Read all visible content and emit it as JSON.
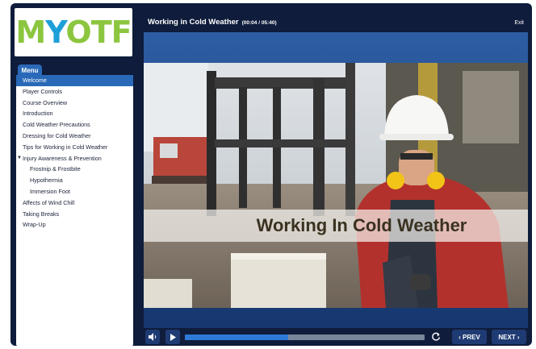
{
  "logo": {
    "text_pre": "M",
    "text_y": "Y",
    "text_post": "OTF"
  },
  "menu": {
    "tab_label": "Menu",
    "items": [
      {
        "label": "Welcome",
        "active": true
      },
      {
        "label": "Player Controls"
      },
      {
        "label": "Course Overview"
      },
      {
        "label": "Introduction"
      },
      {
        "label": "Cold Weather Precautions"
      },
      {
        "label": "Dressing for Cold Weather"
      },
      {
        "label": "Tips for Working in Cold Weather"
      },
      {
        "label": "Injury Awareness & Prevention",
        "expanded": true
      },
      {
        "label": "Frostnip & Frostbite",
        "sub": true
      },
      {
        "label": "Hypothermia",
        "sub": true
      },
      {
        "label": "Immersion Foot",
        "sub": true
      },
      {
        "label": "Affects of Wind Chill"
      },
      {
        "label": "Taking Breaks"
      },
      {
        "label": "Wrap-Up"
      }
    ]
  },
  "header": {
    "course_title": "Working in Cold Weather",
    "time": "(00:04 / 05:40)",
    "exit_label": "Exit"
  },
  "slide": {
    "title": "Working In Cold Weather"
  },
  "controls": {
    "prev_label": "‹ PREV",
    "next_label": "NEXT ›",
    "progress_fraction": 0.43,
    "volume_icon": "volume-icon",
    "play_icon": "play-icon",
    "replay_icon": "replay-icon"
  },
  "colors": {
    "accent": "#2a69b8",
    "frame": "#0f1c3b",
    "logo_green": "#8cc63f",
    "logo_blue": "#1e9fd8"
  }
}
